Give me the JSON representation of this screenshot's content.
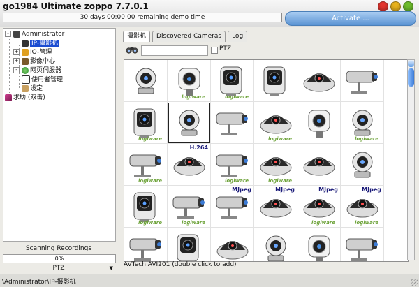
{
  "window": {
    "title": "go1984 Ultimate zoppo 7.7.0.1",
    "demo_text": "30 days 00:00:00 remaining demo time",
    "activate_label": "Activate ...",
    "trafficlights": [
      {
        "name": "close-button",
        "color": "#e3352e"
      },
      {
        "name": "minimize-button",
        "color": "#e8b21c"
      },
      {
        "name": "zoom-button",
        "color": "#6dbb2b"
      }
    ]
  },
  "tree": {
    "items": [
      {
        "label": "Administrator",
        "icon": "admin-icon",
        "expander": "-",
        "color": "#444444"
      },
      {
        "label": "IP-摄影机",
        "icon": "camera-icon",
        "expander": "",
        "color": "#333333",
        "selected": true
      },
      {
        "label": "IO-管理",
        "icon": "io-icon",
        "expander": "+",
        "color": "#e0a020"
      },
      {
        "label": "影像中心",
        "icon": "video-icon",
        "expander": "+",
        "color": "#7a5a2a"
      },
      {
        "label": "网页伺服器",
        "icon": "globe-icon",
        "expander": "-",
        "color": "#2a8a2a"
      },
      {
        "label": "使用者管理",
        "icon": "users-icon",
        "expander": "",
        "color": "#333333"
      },
      {
        "label": "设定",
        "icon": "settings-icon",
        "expander": "",
        "color": "#c8a060"
      },
      {
        "label": "求助 (双击)",
        "icon": "help-book-icon",
        "expander": "",
        "color": "#a02050"
      }
    ]
  },
  "scanning": {
    "label": "Scanning Recordings",
    "progress_text": "0%",
    "progress_value": 0
  },
  "ptz_select": {
    "label": "PTZ"
  },
  "tabs": [
    {
      "label": "摄影机",
      "active": true
    },
    {
      "label": "Discovered Cameras",
      "active": false
    },
    {
      "label": "Log",
      "active": false
    }
  ],
  "search": {
    "value": "",
    "ptz_label": "PTZ"
  },
  "cameras": {
    "badges": {
      "h264": "H.264",
      "mjpeg": "MJpeg",
      "logo": "logiware"
    },
    "tiles": [
      {
        "icon": "ptz-camera-icon"
      },
      {
        "icon": "network-camera-icon",
        "logo": true
      },
      {
        "icon": "box-camera-icon",
        "logo": true
      },
      {
        "icon": "box-camera-icon"
      },
      {
        "icon": "dome-camera-icon"
      },
      {
        "icon": "bullet-camera-icon"
      },
      {
        "icon": "box-camera-icon",
        "logo": true
      },
      {
        "icon": "ptz-camera-icon"
      },
      {
        "icon": "bullet-camera-icon"
      },
      {
        "icon": "dome-camera-icon",
        "logo": true
      },
      {
        "icon": "network-camera-icon"
      },
      {
        "icon": "ptz-camera-icon",
        "logo": true
      },
      {
        "icon": "bullet-camera-icon",
        "logo": true
      },
      {
        "icon": "dome-camera-icon",
        "badge": "h264"
      },
      {
        "icon": "bullet-camera-icon",
        "logo": true
      },
      {
        "icon": "dome-camera-icon",
        "logo": true
      },
      {
        "icon": "dome-camera-icon"
      },
      {
        "icon": "ptz-camera-icon"
      },
      {
        "icon": "box-camera-icon",
        "logo": true
      },
      {
        "icon": "bullet-camera-icon",
        "logo": true
      },
      {
        "icon": "bullet-camera-icon",
        "badge": "mjpeg"
      },
      {
        "icon": "dome-camera-icon",
        "badge": "mjpeg"
      },
      {
        "icon": "dome-camera-icon",
        "badge": "mjpeg",
        "logo": true
      },
      {
        "icon": "dome-camera-icon",
        "badge": "mjpeg",
        "logo": true
      },
      {
        "icon": "bullet-camera-icon"
      },
      {
        "icon": "box-camera-icon"
      },
      {
        "icon": "dome-camera-icon"
      },
      {
        "icon": "ptz-camera-icon"
      },
      {
        "icon": "network-camera-icon"
      },
      {
        "icon": "bullet-camera-icon"
      }
    ],
    "selected_index": 7
  },
  "hint": "AVTech AVI201 (double click to add)",
  "status": {
    "path": "\\Administrator\\IP-摄影机"
  }
}
